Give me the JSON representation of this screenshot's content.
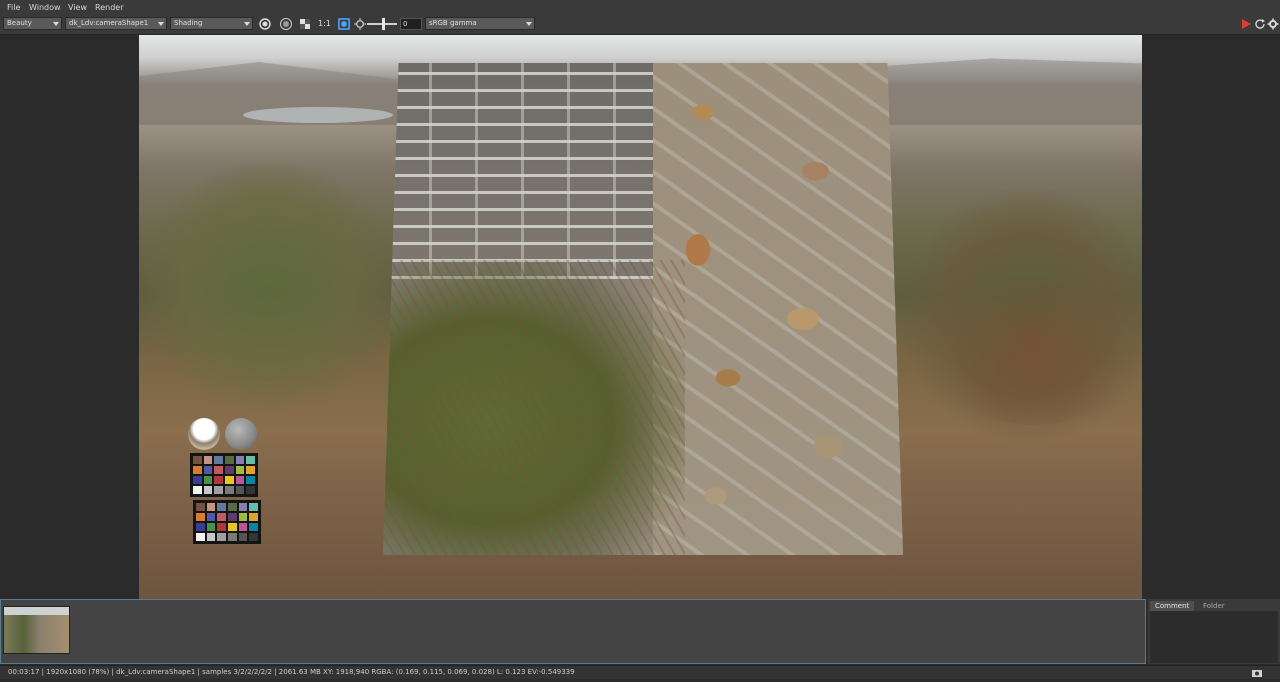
{
  "menu": {
    "file": "File",
    "window": "Window",
    "view": "View",
    "render": "Render"
  },
  "toolbar": {
    "aov": "Beauty",
    "camera": "dk_Ldv:cameraShape1",
    "shading": "Shading",
    "ratio": "1:1",
    "exposure_value": "0",
    "colorspace": "sRGB gamma"
  },
  "colors": {
    "accent_red": "#e03a3a"
  },
  "icons": [
    "sphere-icon",
    "disc-icon",
    "checkerboard-icon",
    "region-icon",
    "exposure-icon",
    "render-play-icon",
    "refresh-icon",
    "gear-icon",
    "snapshot-icon"
  ],
  "bottom_tabs": {
    "comment": "Comment",
    "folder": "Folder"
  },
  "status": "00:03:17 | 1920x1080 (78%) | dk_Ldv:cameraShape1 | samples 3/2/2/2/2/2 | 2061.63 MB XY: 1918,940  RGBA: (0.169, 0.115, 0.069, 0.028)  L: 0.123 EV:-0.549339",
  "checker_colors": [
    "#735244",
    "#c29682",
    "#627a9d",
    "#576c43",
    "#8580b1",
    "#67bdaa",
    "#d67e2c",
    "#505ba6",
    "#c15a63",
    "#5e3c6c",
    "#9dbc40",
    "#e0a32e",
    "#383d96",
    "#469449",
    "#af363c",
    "#e7c71f",
    "#bb5695",
    "#0885a1",
    "#f3f3f2",
    "#c8c8c8",
    "#a0a0a0",
    "#7a7a79",
    "#555555",
    "#343434"
  ]
}
